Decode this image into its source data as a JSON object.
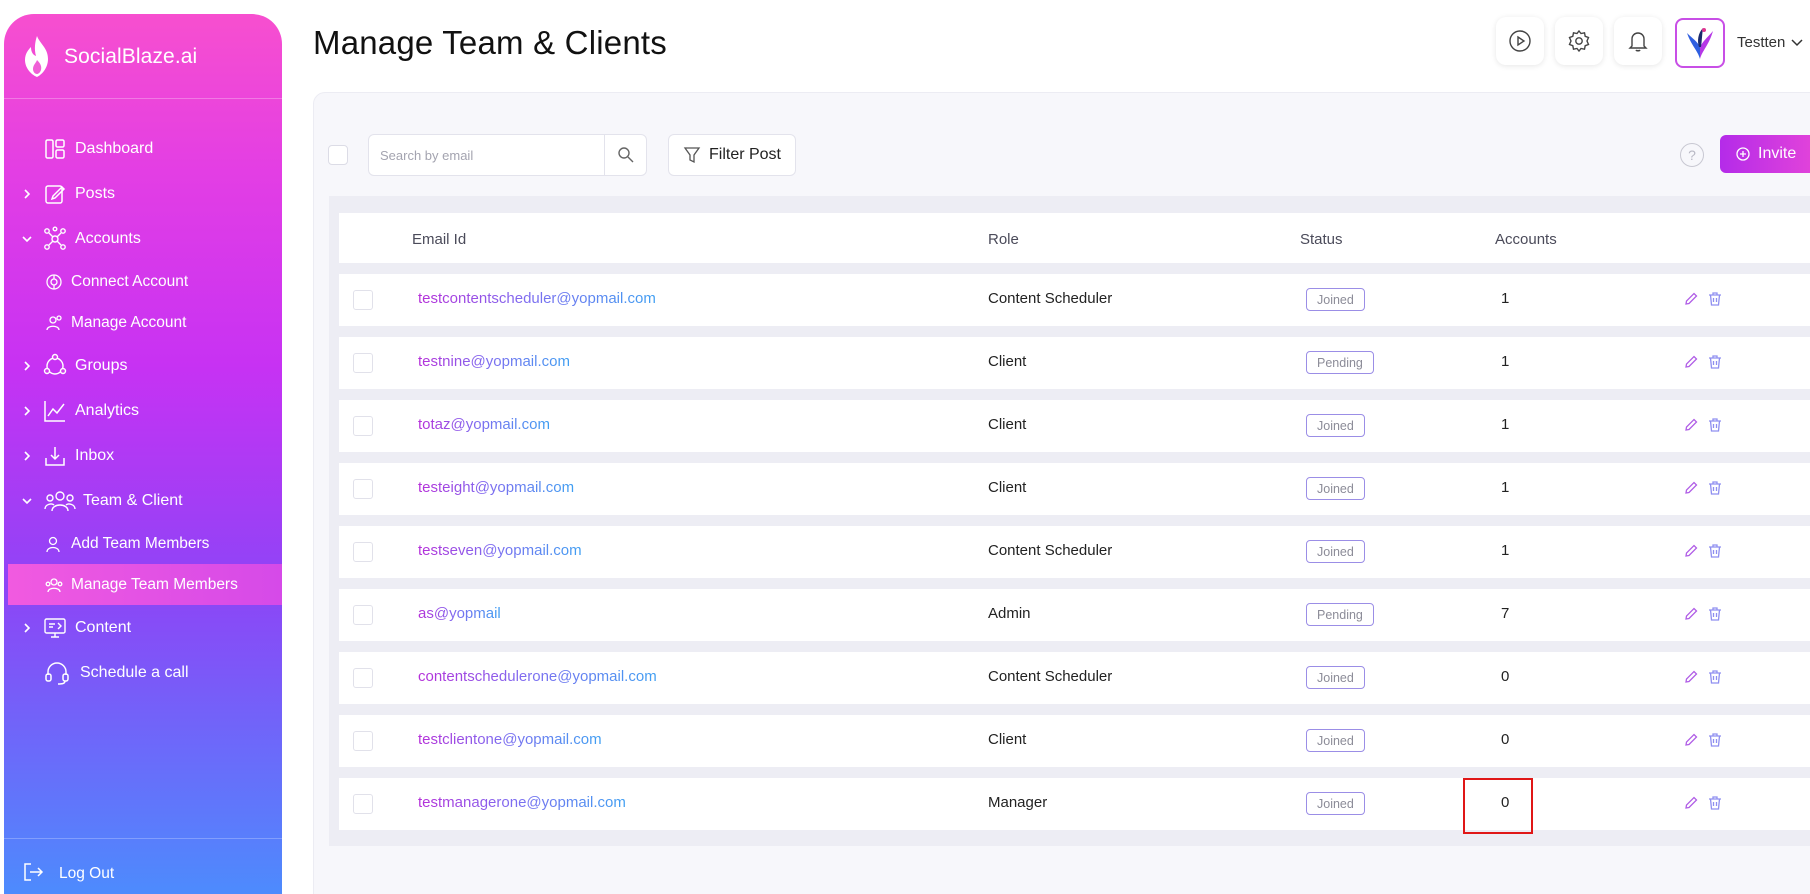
{
  "brand": {
    "name": "SocialBlaze.ai"
  },
  "sidebar": {
    "items": [
      {
        "label": "Dashboard",
        "icon": "dashboard-icon",
        "has_chevron": false,
        "expanded": false
      },
      {
        "label": "Posts",
        "icon": "edit-icon",
        "has_chevron": true,
        "expanded": false
      },
      {
        "label": "Accounts",
        "icon": "network-icon",
        "has_chevron": true,
        "expanded": true
      },
      {
        "label": "Connect Account",
        "icon": "connect-icon",
        "sub": true
      },
      {
        "label": "Manage Account",
        "icon": "manage-account-icon",
        "sub": true
      },
      {
        "label": "Groups",
        "icon": "groups-icon",
        "has_chevron": true,
        "expanded": false
      },
      {
        "label": "Analytics",
        "icon": "analytics-icon",
        "has_chevron": true,
        "expanded": false
      },
      {
        "label": "Inbox",
        "icon": "inbox-icon",
        "has_chevron": true,
        "expanded": false
      },
      {
        "label": "Team & Client",
        "icon": "team-icon",
        "has_chevron": true,
        "expanded": true
      },
      {
        "label": "Add Team Members",
        "icon": "add-member-icon",
        "sub": true
      },
      {
        "label": "Manage Team Members",
        "icon": "manage-members-icon",
        "sub": true,
        "active": true
      },
      {
        "label": "Content",
        "icon": "content-icon",
        "has_chevron": true,
        "expanded": false
      },
      {
        "label": "Schedule a call",
        "icon": "headset-icon",
        "has_chevron": false
      }
    ],
    "logout": "Log Out"
  },
  "header": {
    "title": "Manage Team & Clients",
    "user_name": "Testten",
    "icons": [
      "play-icon",
      "gear-icon",
      "bell-icon"
    ]
  },
  "toolbar": {
    "search_placeholder": "Search by email",
    "filter_label": "Filter Post",
    "help": "?",
    "invite_label": "Invite"
  },
  "table": {
    "columns": {
      "email": "Email Id",
      "role": "Role",
      "status": "Status",
      "accounts": "Accounts"
    },
    "rows": [
      {
        "email": "testcontentscheduler@yopmail.com",
        "role": "Content Scheduler",
        "status": "Joined",
        "accounts": "1"
      },
      {
        "email": "testnine@yopmail.com",
        "role": "Client",
        "status": "Pending",
        "accounts": "1"
      },
      {
        "email": "totaz@yopmail.com",
        "role": "Client",
        "status": "Joined",
        "accounts": "1"
      },
      {
        "email": "testeight@yopmail.com",
        "role": "Client",
        "status": "Joined",
        "accounts": "1"
      },
      {
        "email": "testseven@yopmail.com",
        "role": "Content Scheduler",
        "status": "Joined",
        "accounts": "1"
      },
      {
        "email": "as@yopmail",
        "role": "Admin",
        "status": "Pending",
        "accounts": "7"
      },
      {
        "email": "contentschedulerone@yopmail.com",
        "role": "Content Scheduler",
        "status": "Joined",
        "accounts": "0"
      },
      {
        "email": "testclientone@yopmail.com",
        "role": "Client",
        "status": "Joined",
        "accounts": "0"
      },
      {
        "email": "testmanagerone@yopmail.com",
        "role": "Manager",
        "status": "Joined",
        "accounts": "0"
      }
    ]
  },
  "colors": {
    "accent": "#c732f3",
    "highlight_box": "#e01717",
    "badge_border": "#9b8ee6"
  }
}
